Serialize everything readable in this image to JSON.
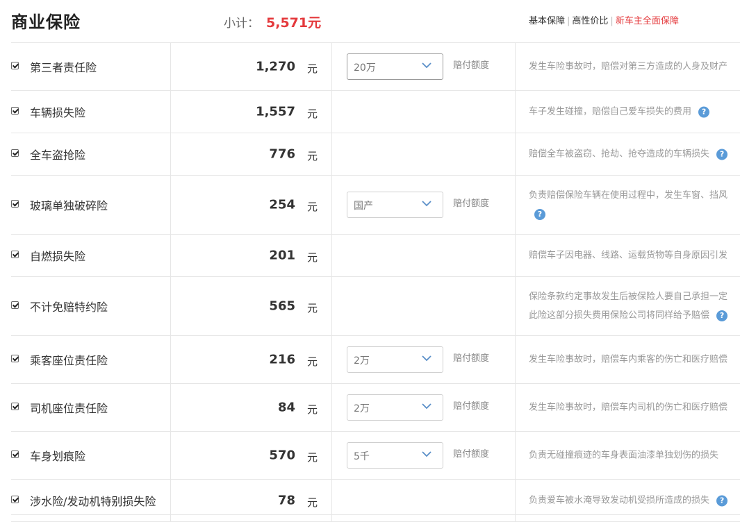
{
  "header": {
    "title": "商业保险",
    "subtotal_label": "小计：",
    "subtotal_value": "5,571元",
    "plans": [
      {
        "label": "基本保障",
        "active": false
      },
      {
        "label": "高性价比",
        "active": false
      },
      {
        "label": "新车主全面保障",
        "active": true
      }
    ],
    "accent_color": "#e4393c"
  },
  "unit": "元",
  "option_label": "赔付额度",
  "rows": [
    {
      "name": "第三者责任险",
      "price": "1,270",
      "checked": true,
      "option": "20万",
      "desc": [
        "发生车险事故时，赔偿对第三方造成的人身及财产"
      ],
      "help": false
    },
    {
      "name": "车辆损失险",
      "price": "1,557",
      "checked": true,
      "option": null,
      "desc": [
        "车子发生碰撞，赔偿自己爱车损失的费用"
      ],
      "help": true
    },
    {
      "name": "全车盗抢险",
      "price": "776",
      "checked": true,
      "option": null,
      "desc": [
        "赔偿全车被盗窃、抢劫、抢夺造成的车辆损失"
      ],
      "help": true
    },
    {
      "name": "玻璃单独破碎险",
      "price": "254",
      "checked": true,
      "option": "国产",
      "desc": [
        "负责赔偿保险车辆在使用过程中，发生车窗、挡风",
        ""
      ],
      "help": true
    },
    {
      "name": "自燃损失险",
      "price": "201",
      "checked": true,
      "option": null,
      "desc": [
        "赔偿车子因电器、线路、运载货物等自身原因引发"
      ],
      "help": false
    },
    {
      "name": "不计免赔特约险",
      "price": "565",
      "checked": true,
      "option": null,
      "desc": [
        "保险条款约定事故发生后被保险人要自己承担一定",
        "此险这部分损失费用保险公司将同样给予赔偿"
      ],
      "help": true
    },
    {
      "name": "乘客座位责任险",
      "price": "216",
      "checked": true,
      "option": "2万",
      "desc": [
        "发生车险事故时，赔偿车内乘客的伤亡和医疗赔偿"
      ],
      "help": false
    },
    {
      "name": "司机座位责任险",
      "price": "84",
      "checked": true,
      "option": "2万",
      "desc": [
        "发生车险事故时，赔偿车内司机的伤亡和医疗赔偿"
      ],
      "help": false
    },
    {
      "name": "车身划痕险",
      "price": "570",
      "checked": true,
      "option": "5千",
      "desc": [
        "负责无碰撞痕迹的车身表面油漆单独划伤的损失"
      ],
      "help": false
    },
    {
      "name": "涉水险/发动机特别损失险",
      "price": "78",
      "checked": true,
      "option": null,
      "desc": [
        "负责爱车被水淹导致发动机受损所造成的损失"
      ],
      "help": true
    }
  ]
}
